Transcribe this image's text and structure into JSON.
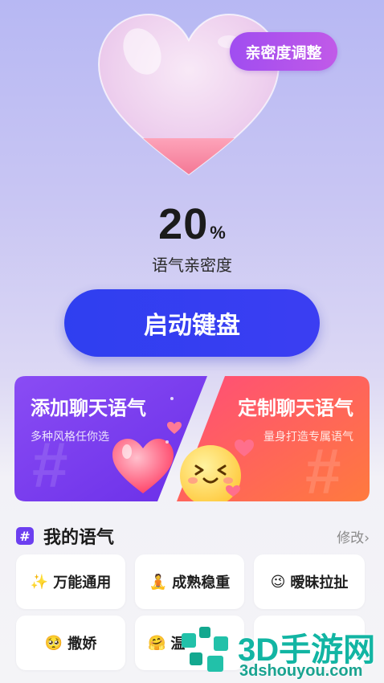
{
  "header": {
    "intimacy_button": "亲密度调整",
    "percent_value": "20",
    "percent_unit": "%",
    "percent_label": "语气亲密度"
  },
  "main": {
    "start_button": "启动键盘"
  },
  "cards": [
    {
      "title": "添加聊天语气",
      "subtitle": "多种风格任你选"
    },
    {
      "title": "定制聊天语气",
      "subtitle": "量身打造专属语气"
    }
  ],
  "my_tones": {
    "title": "我的语气",
    "hash": "#",
    "edit": "修改",
    "edit_chevron": "›",
    "items": [
      {
        "emoji": "✨",
        "label": "万能通用"
      },
      {
        "emoji": "🧘",
        "label": "成熟稳重"
      },
      {
        "emoji": "😉",
        "label": "暧昧拉扯"
      },
      {
        "emoji": "🥺",
        "label": "撒娇"
      },
      {
        "emoji": "🤗",
        "label": "温"
      }
    ]
  },
  "watermark": {
    "brand": "3D手游网",
    "url": "3dshouyou.com"
  },
  "colors": {
    "accent_blue": "#2f3ff0",
    "accent_purple": "#a04df0",
    "card_left": "#7a3cf0",
    "card_right": "#ff4f6e"
  }
}
